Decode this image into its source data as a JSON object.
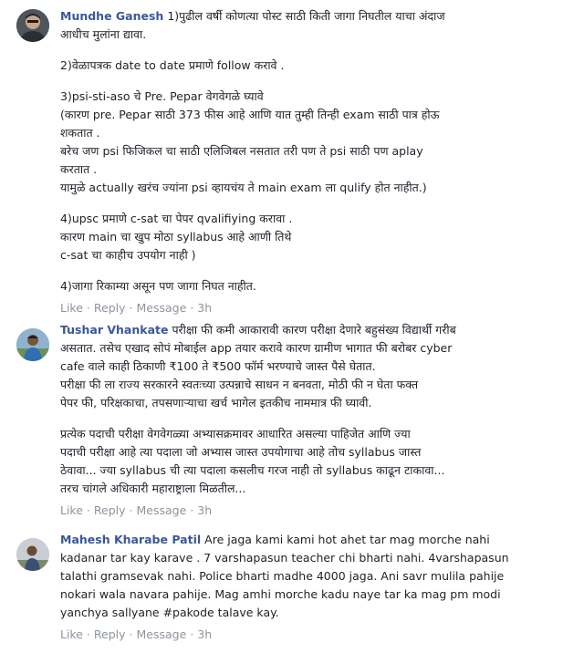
{
  "comments": [
    {
      "author": "Mundhe Ganesh",
      "paragraphs": [
        [
          "1)पुढील वर्षी कोणत्या पोस्ट साठी किती जागा निघतील याचा अंदाज",
          "आधीच मुलांना द्यावा."
        ],
        [
          "2)वेळापत्रक date to date प्रमाणे follow करावे ."
        ],
        [
          "3)psi-sti-aso चे Pre. Pepar वेगवेगळे घ्यावे",
          "(कारण pre. Pepar साठी 373 फीस आहे आणि यात तुम्ही तिन्ही exam साठी पात्र होऊ",
          "शकतात .",
          "बरेच जण psi फिजिकल चा साठी एलिजिबल नसतात तरी पण ते psi साठी पण aplay",
          "करतात .",
          "यामुळे actually खरंच ज्यांना psi व्हायचंय ते main exam ला qulify होत नाहीत.)"
        ],
        [
          "4)upsc प्रमाणे c-sat चा पेपर qvalifiying करावा .",
          "कारण main चा खुप मोठा syllabus आहे आणी तिथे",
          "c-sat चा काहीच उपयोग नाही )"
        ],
        [
          "4)जागा रिकाम्या असून पण जागा निघत नाहीत."
        ]
      ],
      "actions": [
        "Like",
        "Reply",
        "Message"
      ],
      "time": "3h"
    },
    {
      "author": "Tushar Vhankate",
      "paragraphs": [
        [
          "परीक्षा फी कमी आकारावी कारण परीक्षा देणारे बहुसंख्य विद्यार्थी गरीब",
          "असतात. तसेच एखाद सोपं मोबाईल app तयार करावे कारण ग्रामीण भागात फी बरोबर cyber",
          "cafe वाले काही ठिकाणी ₹100 ते ₹500 फॉर्म भरण्याचे जास्त पैसे घेतात.",
          "परीक्षा फी ला राज्य सरकारने स्वतःच्या उत्पन्नाचे साधन न बनवता, मोठी फी न घेता फक्त",
          "पेपर फी, परिक्षकाचा, तपसणाऱ्याचा खर्च भागेल इतकीच नाममात्र फी घ्यावी."
        ],
        [
          "प्रत्येक पदाची परीक्षा वेगवेगळ्या अभ्यासक्रमावर आधारित असल्या पाहिजेत आणि ज्या",
          "पदाची परीक्षा आहे त्या पदाला जो अभ्यास जास्त उपयोगाचा आहे तोच syllabus जास्त",
          "ठेवावा... ज्या syllabus ची त्या पदाला कसलीच गरज नाही तो syllabus काढून टाकावा...",
          "तरच चांगले अधिकारी महाराष्ट्राला मिळतील..."
        ]
      ],
      "actions": [
        "Like",
        "Reply",
        "Message"
      ],
      "time": "3h"
    },
    {
      "author": "Mahesh Kharabe Patil",
      "paragraphs": [
        [
          "Are jaga kami kami hot ahet tar mag morche nahi",
          "kadanar tar kay karave . 7 varshapasun teacher chi bharti nahi. 4varshapasun",
          "talathi gramsevak nahi. Police bharti madhe 4000 jaga. Ani savr mulila pahije",
          "nokari wala navara pahije. Mag amhi morche kadu naye tar ka mag pm modi",
          "yanchya sallyane #pakode talave kay."
        ]
      ],
      "actions": [
        "Like",
        "Reply",
        "Message"
      ],
      "time": "3h"
    }
  ]
}
